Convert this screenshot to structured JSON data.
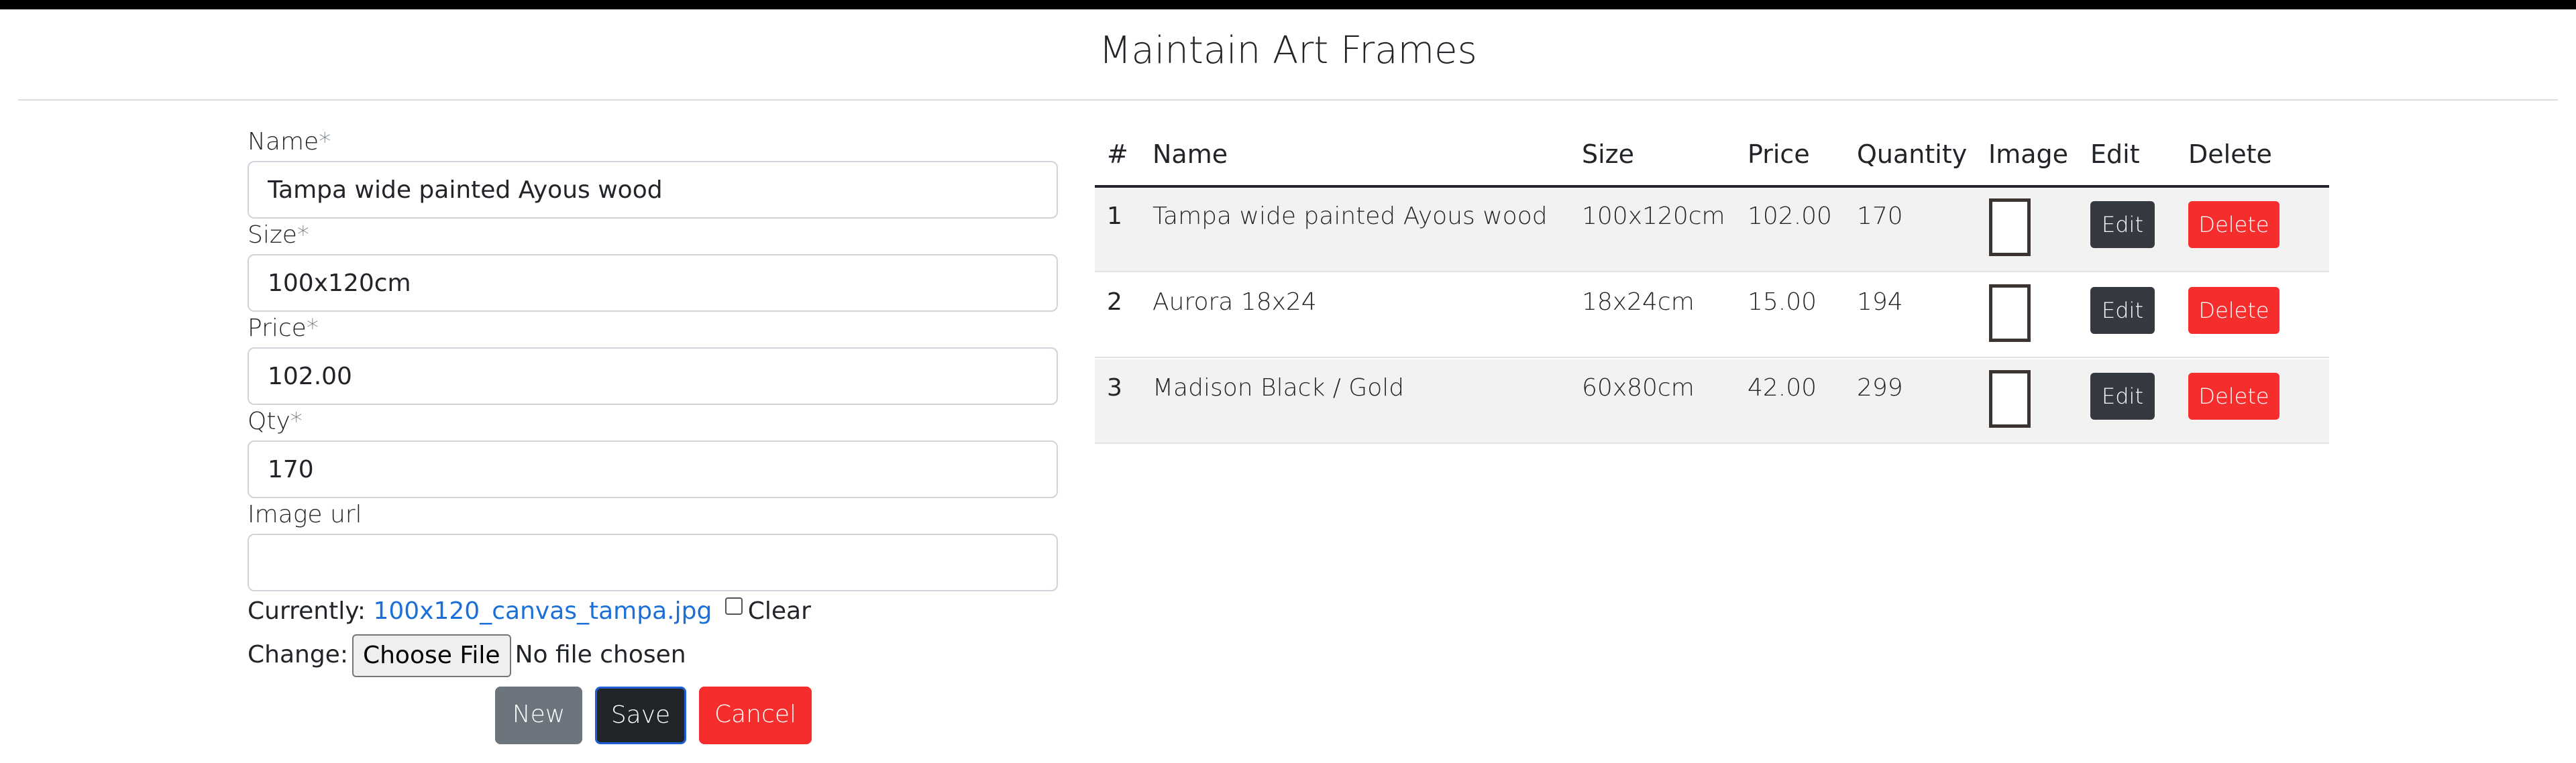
{
  "page": {
    "title": "Maintain Art Frames"
  },
  "form": {
    "name": {
      "label": "Name",
      "required_mark": "*",
      "value": "Tampa wide painted Ayous wood"
    },
    "size": {
      "label": "Size",
      "required_mark": "*",
      "value": "100x120cm"
    },
    "price": {
      "label": "Price",
      "required_mark": "*",
      "value": "102.00"
    },
    "qty": {
      "label": "Qty",
      "required_mark": "*",
      "value": "170"
    },
    "image_url": {
      "label": "Image url",
      "value": ""
    },
    "currently": {
      "prefix": "Currently:",
      "file_link": "100x120_canvas_tampa.jpg",
      "clear_label": "Clear"
    },
    "change": {
      "prefix": "Change:",
      "choose_file": "Choose File",
      "no_file": "No file chosen"
    },
    "buttons": {
      "new": "New",
      "save": "Save",
      "cancel": "Cancel"
    }
  },
  "table": {
    "headers": {
      "num": "#",
      "name": "Name",
      "size": "Size",
      "price": "Price",
      "quantity": "Quantity",
      "image": "Image",
      "edit": "Edit",
      "delete": "Delete"
    },
    "rows": [
      {
        "num": "1",
        "name": "Tampa wide painted Ayous wood",
        "size": "100x120cm",
        "price": "102.00",
        "quantity": "170",
        "edit": "Edit",
        "delete": "Delete"
      },
      {
        "num": "2",
        "name": "Aurora 18x24",
        "size": "18x24cm",
        "price": "15.00",
        "quantity": "194",
        "edit": "Edit",
        "delete": "Delete"
      },
      {
        "num": "3",
        "name": "Madison Black / Gold",
        "size": "60x80cm",
        "price": "42.00",
        "quantity": "299",
        "edit": "Edit",
        "delete": "Delete"
      }
    ]
  },
  "colors": {
    "danger": "#f52d2d",
    "dark": "#343a40",
    "secondary": "#6c757d",
    "link": "#1a6fd8"
  }
}
